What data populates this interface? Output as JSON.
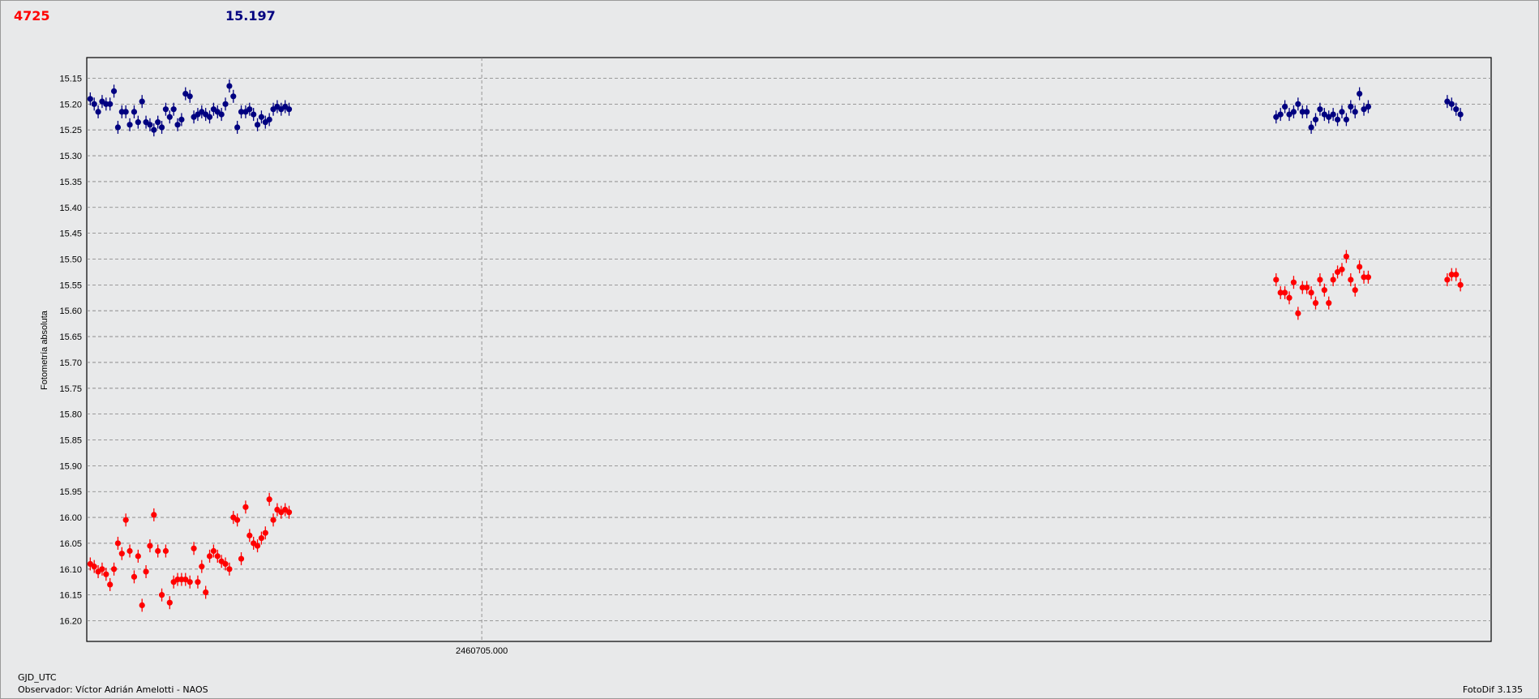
{
  "header": {
    "left_value": "4725",
    "right_value": "15.197"
  },
  "footer": {
    "x_caption": "GJD_UTC",
    "observer": "Observador: Víctor Adrián Amelotti - NAOS",
    "software": "FotoDif 3.135"
  },
  "colors": {
    "series_comp": "#000080",
    "series_var": "#ff0000",
    "plot_bg": "#e8e9ea",
    "grid": "#808080"
  },
  "chart_data": {
    "type": "scatter",
    "ylabel": "Fotometría absoluta",
    "y_inverted": true,
    "ylim": [
      15.11,
      16.24
    ],
    "yticks": [
      "15.15",
      "15.20",
      "15.25",
      "15.30",
      "15.35",
      "15.40",
      "15.45",
      "15.50",
      "15.55",
      "15.60",
      "15.65",
      "15.70",
      "15.75",
      "15.80",
      "15.85",
      "15.90",
      "15.95",
      "16.00",
      "16.05",
      "16.10",
      "16.15",
      "16.20"
    ],
    "xlim": [
      2460704.1,
      2460707.3
    ],
    "xticks": [
      {
        "value": 2460705.0,
        "label": "2460705.000"
      }
    ],
    "grid": true,
    "series": [
      {
        "color": "#000080",
        "x": [
          2460704.108,
          2460704.117,
          2460704.126,
          2460704.135,
          2460704.144,
          2460704.153,
          2460704.162,
          2460704.171,
          2460704.18,
          2460704.189,
          2460704.198,
          2460704.208,
          2460704.217,
          2460704.226,
          2460704.235,
          2460704.244,
          2460704.253,
          2460704.262,
          2460704.271,
          2460704.28,
          2460704.289,
          2460704.298,
          2460704.307,
          2460704.316,
          2460704.325,
          2460704.335,
          2460704.344,
          2460704.353,
          2460704.362,
          2460704.371,
          2460704.38,
          2460704.389,
          2460704.398,
          2460704.407,
          2460704.416,
          2460704.425,
          2460704.434,
          2460704.443,
          2460704.452,
          2460704.462,
          2460704.471,
          2460704.48,
          2460704.489,
          2460704.498,
          2460704.507,
          2460704.516,
          2460704.525,
          2460704.534,
          2460704.543,
          2460704.552,
          2460704.561
        ],
        "y": [
          15.19,
          15.2,
          15.215,
          15.195,
          15.2,
          15.2,
          15.175,
          15.245,
          15.215,
          15.215,
          15.24,
          15.215,
          15.235,
          15.195,
          15.235,
          15.24,
          15.25,
          15.235,
          15.245,
          15.21,
          15.225,
          15.21,
          15.24,
          15.23,
          15.18,
          15.185,
          15.225,
          15.22,
          15.215,
          15.22,
          15.225,
          15.21,
          15.215,
          15.22,
          15.2,
          15.165,
          15.185,
          15.245,
          15.215,
          15.215,
          15.21,
          15.22,
          15.24,
          15.225,
          15.235,
          15.23,
          15.21,
          15.205,
          15.21,
          15.205,
          15.21
        ]
      },
      {
        "color": "#ff0000",
        "x": [
          2460704.108,
          2460704.117,
          2460704.126,
          2460704.135,
          2460704.144,
          2460704.153,
          2460704.162,
          2460704.171,
          2460704.18,
          2460704.189,
          2460704.198,
          2460704.208,
          2460704.217,
          2460704.226,
          2460704.235,
          2460704.244,
          2460704.253,
          2460704.262,
          2460704.271,
          2460704.28,
          2460704.289,
          2460704.298,
          2460704.307,
          2460704.316,
          2460704.325,
          2460704.335,
          2460704.344,
          2460704.353,
          2460704.362,
          2460704.371,
          2460704.38,
          2460704.389,
          2460704.398,
          2460704.407,
          2460704.416,
          2460704.425,
          2460704.434,
          2460704.443,
          2460704.452,
          2460704.462,
          2460704.471,
          2460704.48,
          2460704.489,
          2460704.498,
          2460704.507,
          2460704.516,
          2460704.525,
          2460704.534,
          2460704.543,
          2460704.552,
          2460704.561
        ],
        "y": [
          16.09,
          16.095,
          16.105,
          16.1,
          16.11,
          16.13,
          16.1,
          16.05,
          16.07,
          16.005,
          16.065,
          16.115,
          16.075,
          16.17,
          16.105,
          16.055,
          15.995,
          16.065,
          16.15,
          16.065,
          16.165,
          16.125,
          16.12,
          16.12,
          16.12,
          16.125,
          16.06,
          16.125,
          16.095,
          16.145,
          16.075,
          16.065,
          16.075,
          16.085,
          16.09,
          16.1,
          16.0,
          16.005,
          16.08,
          15.98,
          16.035,
          16.05,
          16.055,
          16.04,
          16.03,
          15.965,
          16.005,
          15.985,
          15.99,
          15.985,
          15.99
        ]
      },
      {
        "color": "#000080",
        "x": [
          2460706.81,
          2460706.82,
          2460706.83,
          2460706.84,
          2460706.85,
          2460706.86,
          2460706.87,
          2460706.88,
          2460706.89,
          2460706.9,
          2460706.91,
          2460706.92,
          2460706.93,
          2460706.94,
          2460706.95,
          2460706.96,
          2460706.97,
          2460706.98,
          2460706.99,
          2460707.0,
          2460707.01,
          2460707.02
        ],
        "y": [
          15.225,
          15.22,
          15.205,
          15.22,
          15.215,
          15.2,
          15.215,
          15.215,
          15.245,
          15.23,
          15.21,
          15.22,
          15.225,
          15.22,
          15.23,
          15.215,
          15.23,
          15.205,
          15.215,
          15.18,
          15.21,
          15.205
        ]
      },
      {
        "color": "#ff0000",
        "x": [
          2460706.81,
          2460706.82,
          2460706.83,
          2460706.84,
          2460706.85,
          2460706.86,
          2460706.87,
          2460706.88,
          2460706.89,
          2460706.9,
          2460706.91,
          2460706.92,
          2460706.93,
          2460706.94,
          2460706.95,
          2460706.96,
          2460706.97,
          2460706.98,
          2460706.99,
          2460707.0,
          2460707.01,
          2460707.02
        ],
        "y": [
          15.54,
          15.565,
          15.565,
          15.575,
          15.545,
          15.605,
          15.555,
          15.555,
          15.565,
          15.585,
          15.54,
          15.56,
          15.585,
          15.54,
          15.525,
          15.52,
          15.495,
          15.54,
          15.56,
          15.515,
          15.535,
          15.535
        ]
      },
      {
        "color": "#000080",
        "x": [
          2460707.2,
          2460707.21,
          2460707.22,
          2460707.23
        ],
        "y": [
          15.195,
          15.2,
          15.21,
          15.22
        ]
      },
      {
        "color": "#ff0000",
        "x": [
          2460707.2,
          2460707.21,
          2460707.22,
          2460707.23
        ],
        "y": [
          15.54,
          15.53,
          15.53,
          15.55
        ]
      }
    ]
  }
}
